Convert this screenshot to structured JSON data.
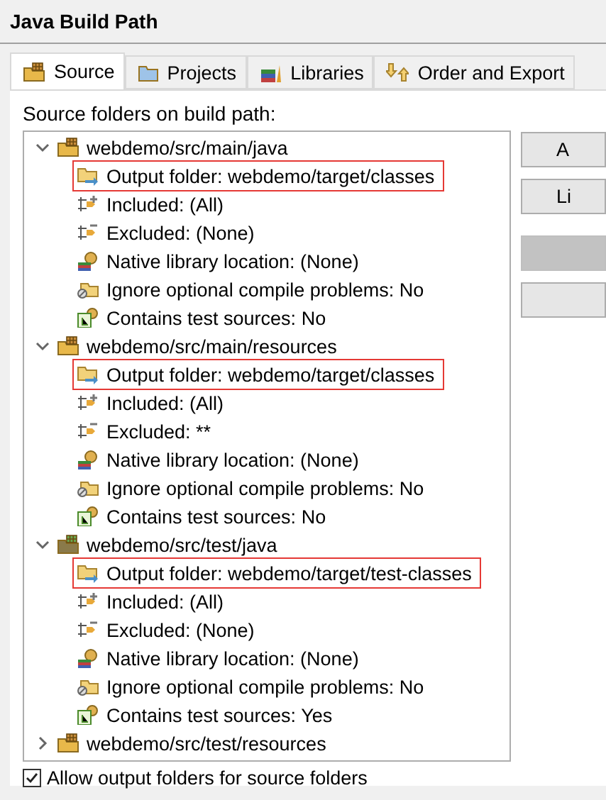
{
  "window": {
    "title": "Java Build Path"
  },
  "tabs": [
    {
      "label": "Source",
      "selected": true,
      "kind": "source"
    },
    {
      "label": "Projects",
      "selected": false,
      "kind": "projects"
    },
    {
      "label": "Libraries",
      "selected": false,
      "kind": "libraries"
    },
    {
      "label": "Order and Export",
      "selected": false,
      "kind": "order"
    }
  ],
  "tree_label": "Source folders on build path:",
  "tree": [
    {
      "label": "webdemo/src/main/java",
      "kind": "source",
      "expanded": true,
      "children": [
        {
          "label": "Output folder: webdemo/target/classes",
          "kind": "output",
          "highlighted": true
        },
        {
          "label": "Included: (All)",
          "kind": "included",
          "highlighted": false
        },
        {
          "label": "Excluded: (None)",
          "kind": "excluded",
          "highlighted": false
        },
        {
          "label": "Native library location: (None)",
          "kind": "native",
          "highlighted": false
        },
        {
          "label": "Ignore optional compile problems: No",
          "kind": "ignore",
          "highlighted": false
        },
        {
          "label": "Contains test sources: No",
          "kind": "tests",
          "highlighted": false
        }
      ]
    },
    {
      "label": "webdemo/src/main/resources",
      "kind": "source",
      "expanded": true,
      "children": [
        {
          "label": "Output folder: webdemo/target/classes",
          "kind": "output",
          "highlighted": true
        },
        {
          "label": "Included: (All)",
          "kind": "included",
          "highlighted": false
        },
        {
          "label": "Excluded: **",
          "kind": "excluded",
          "highlighted": false
        },
        {
          "label": "Native library location: (None)",
          "kind": "native",
          "highlighted": false
        },
        {
          "label": "Ignore optional compile problems: No",
          "kind": "ignore",
          "highlighted": false
        },
        {
          "label": "Contains test sources: No",
          "kind": "tests",
          "highlighted": false
        }
      ]
    },
    {
      "label": "webdemo/src/test/java",
      "kind": "test-source",
      "expanded": true,
      "children": [
        {
          "label": "Output folder: webdemo/target/test-classes",
          "kind": "output",
          "highlighted": true
        },
        {
          "label": "Included: (All)",
          "kind": "included",
          "highlighted": false
        },
        {
          "label": "Excluded: (None)",
          "kind": "excluded",
          "highlighted": false
        },
        {
          "label": "Native library location: (None)",
          "kind": "native",
          "highlighted": false
        },
        {
          "label": "Ignore optional compile problems: No",
          "kind": "ignore",
          "highlighted": false
        },
        {
          "label": "Contains test sources: Yes",
          "kind": "tests",
          "highlighted": false
        }
      ]
    },
    {
      "label": "webdemo/src/test/resources",
      "kind": "source",
      "expanded": false
    }
  ],
  "side_buttons": [
    {
      "label": "A",
      "disabled": false
    },
    {
      "label": "Li",
      "disabled": false
    },
    {
      "disabled": true
    },
    {
      "disabled": false
    }
  ],
  "allow_output": {
    "label": "Allow output folders for source folders",
    "checked": true
  }
}
